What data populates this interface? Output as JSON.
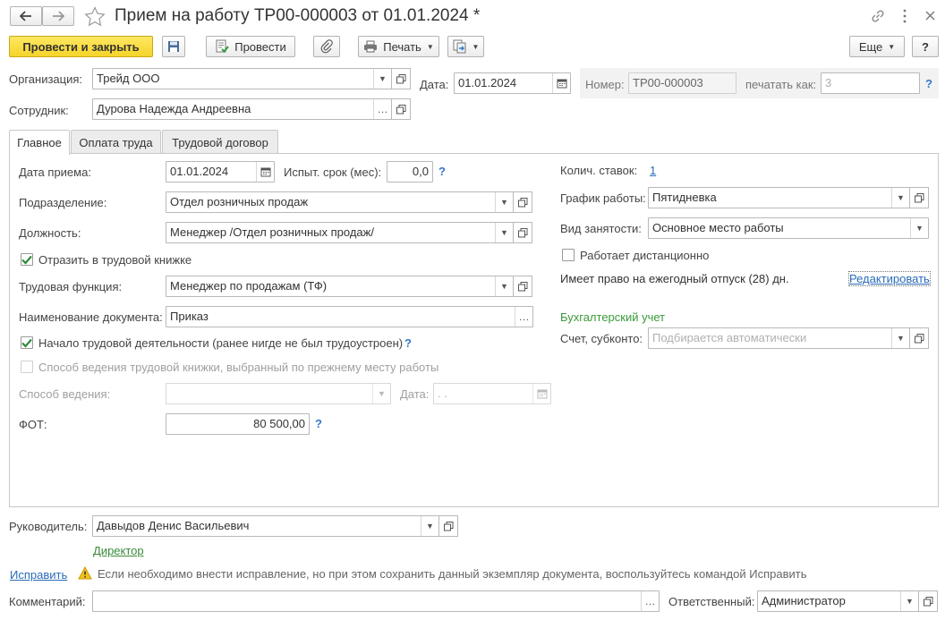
{
  "header": {
    "title": "Прием на работу ТР00-000003 от 01.01.2024 *"
  },
  "toolbar": {
    "post_close_label": "Провести и закрыть",
    "post_label": "Провести",
    "print_label": "Печать",
    "more_label": "Еще",
    "help_label": "?"
  },
  "top_fields": {
    "org_label": "Организация:",
    "org_value": "Трейд ООО",
    "date_label": "Дата:",
    "date_value": "01.01.2024",
    "number_label": "Номер:",
    "number_value": "ТР00-000003",
    "print_as_label": "печатать как:",
    "print_as_placeholder": "3",
    "employee_label": "Сотрудник:",
    "employee_value": "Дурова Надежда Андреевна"
  },
  "tabs": [
    {
      "label": "Главное"
    },
    {
      "label": "Оплата труда"
    },
    {
      "label": "Трудовой договор"
    }
  ],
  "main": {
    "hire_date_label": "Дата приема:",
    "hire_date_value": "01.01.2024",
    "probation_label": "Испыт. срок (мес):",
    "probation_value": "0,0",
    "division_label": "Подразделение:",
    "division_value": "Отдел розничных продаж",
    "position_label": "Должность:",
    "position_value": "Менеджер /Отдел розничных продаж/",
    "workbook_check_label": "Отразить в трудовой книжке",
    "labor_function_label": "Трудовая функция:",
    "labor_function_value": "Менеджер по продажам (ТФ)",
    "doc_name_label": "Наименование документа:",
    "doc_name_value": "Приказ",
    "first_job_label": "Начало трудовой деятельности (ранее нигде не был трудоустроен)",
    "prev_method_label": "Способ ведения трудовой книжки, выбранный по прежнему месту работы",
    "method_label": "Способ ведения:",
    "method_date_label": "Дата:",
    "method_date_value": " .  .",
    "fot_label": "ФОТ:",
    "fot_value": "80 500,00",
    "rates_label": "Колич. ставок:",
    "rates_value": "1",
    "schedule_label": "График работы:",
    "schedule_value": "Пятидневка",
    "employment_label": "Вид занятости:",
    "employment_value": "Основное место работы",
    "remote_label": "Работает дистанционно",
    "vacation_text": "Имеет право на ежегодный отпуск (28) дн.",
    "edit_link": "Редактировать",
    "accounting_header": "Бухгалтерский учет",
    "account_label": "Счет, субконто:",
    "account_placeholder": "Подбирается автоматически",
    "help_mark": "?"
  },
  "footer": {
    "manager_label": "Руководитель:",
    "manager_value": "Давыдов Денис Васильевич",
    "manager_position": "Директор",
    "fix_link": "Исправить",
    "fix_note": "Если необходимо внести исправление, но при этом сохранить данный экземпляр документа, воспользуйтесь командой Исправить",
    "comment_label": "Комментарий:",
    "comment_value": "",
    "responsible_label": "Ответственный:",
    "responsible_value": "Администратор"
  },
  "colors": {
    "primary_button": "#f5d42a",
    "link": "#2a6bb8",
    "accounting_header": "#3a9a3a",
    "check_mark": "#2f8a3a",
    "help_mark": "#3377cc"
  },
  "icons": [
    "back-arrow-icon",
    "forward-arrow-icon",
    "star-icon",
    "link-icon",
    "kebab-menu-icon",
    "close-icon",
    "save-disk-icon",
    "post-doc-icon",
    "paperclip-icon",
    "printer-icon",
    "create-based-icon",
    "calendar-icon",
    "open-form-icon",
    "warning-icon"
  ]
}
